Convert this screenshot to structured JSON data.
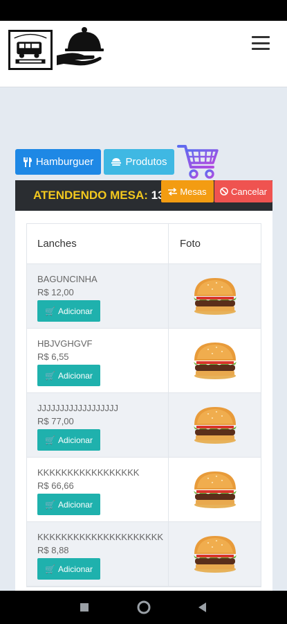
{
  "header": {
    "logo_name": "logo-badge",
    "menu_icon": "hamburger-menu-icon"
  },
  "categories": [
    {
      "label": "Hamburguer",
      "icon": "fork-knife-icon"
    },
    {
      "label": "Produtos",
      "icon": "product-icon"
    }
  ],
  "panel": {
    "title_prefix": "ATENDENDO MESA:",
    "table_number": "13",
    "mesas_label": "Mesas",
    "cancel_label": "Cancelar"
  },
  "table": {
    "col_lanches": "Lanches",
    "col_foto": "Foto",
    "add_label": "Adicionar",
    "rows": [
      {
        "name": "BAGUNCINHA",
        "price": "R$ 12,00"
      },
      {
        "name": "HBJVGHGVF",
        "price": "R$ 6,55"
      },
      {
        "name": "JJJJJJJJJJJJJJJJJJ",
        "price": "R$ 77,00"
      },
      {
        "name": "KKKKKKKKKKKKKKKKK",
        "price": "R$ 66,66"
      },
      {
        "name": "KKKKKKKKKKKKKKKKKKKKK",
        "price": "R$ 8,88"
      }
    ]
  },
  "colors": {
    "accent_blue": "#1e88e5",
    "light_blue": "#3fb8e3",
    "teal": "#1fb1ad",
    "orange": "#f39c12",
    "red": "#ef5350",
    "yellow": "#f3c81e",
    "dark": "#2a2d31"
  }
}
